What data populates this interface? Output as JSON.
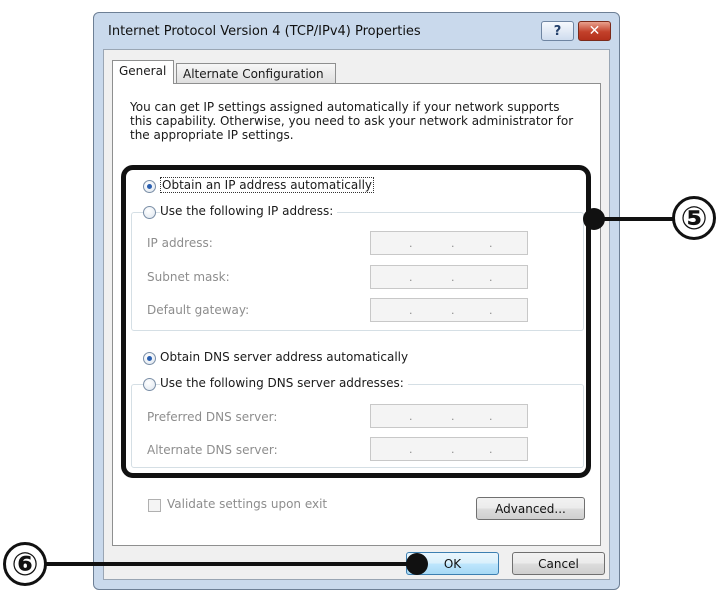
{
  "window": {
    "title": "Internet Protocol Version 4 (TCP/IPv4) Properties",
    "help_label": "?",
    "close_label": "✕"
  },
  "tabs": [
    {
      "label": "General",
      "selected": true
    },
    {
      "label": "Alternate Configuration",
      "selected": false
    }
  ],
  "intro_text": "You can get IP settings assigned automatically if your network supports this capability. Otherwise, you need to ask your network administrator for the appropriate IP settings.",
  "ip": {
    "auto_label": "Obtain an IP address automatically",
    "auto_selected": true,
    "manual_label": "Use the following IP address:",
    "fields": [
      {
        "label": "IP address:",
        "value": ". . ."
      },
      {
        "label": "Subnet mask:",
        "value": ". . ."
      },
      {
        "label": "Default gateway:",
        "value": ". . ."
      }
    ]
  },
  "dns": {
    "auto_label": "Obtain DNS server address automatically",
    "auto_selected": true,
    "manual_label": "Use the following DNS server addresses:",
    "fields": [
      {
        "label": "Preferred DNS server:",
        "value": ". . ."
      },
      {
        "label": "Alternate DNS server:",
        "value": ". . ."
      }
    ]
  },
  "validate_label": "Validate settings upon exit",
  "validate_checked": false,
  "advanced_label": "Advanced...",
  "ok_label": "OK",
  "cancel_label": "Cancel",
  "annotations": {
    "callout_5": "⑤",
    "callout_6": "⑥"
  },
  "colors": {
    "frame": "#c9d9ec",
    "panel": "#ffffff",
    "close_button": "#c2402a",
    "callout": "#111111"
  }
}
